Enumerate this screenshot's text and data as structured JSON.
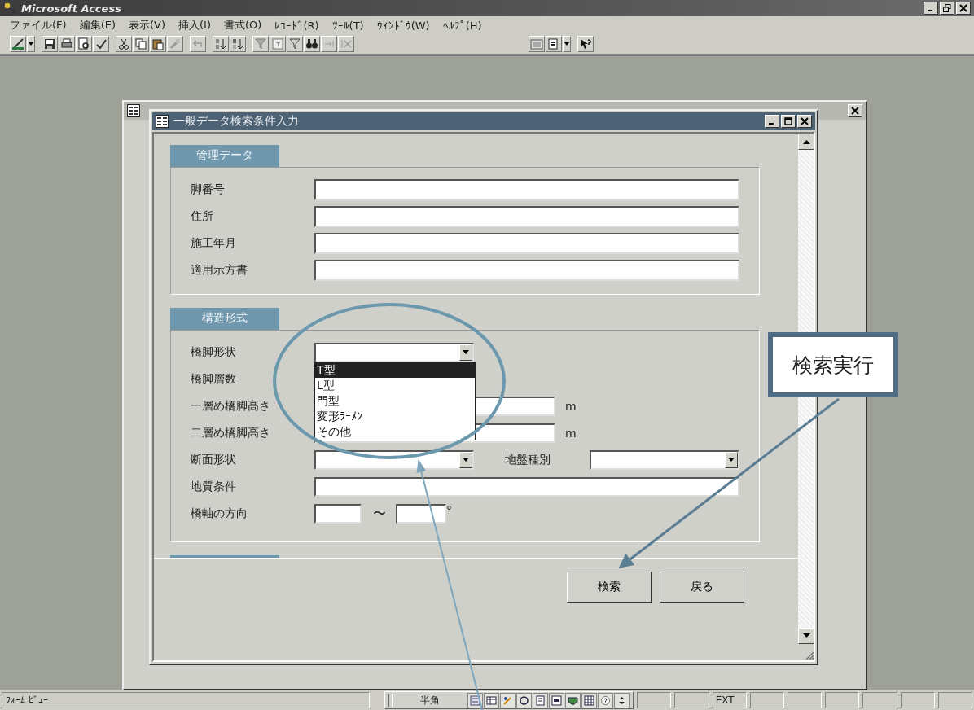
{
  "app": {
    "title": "Microsoft Access"
  },
  "menu": [
    "ファイル(F)",
    "編集(E)",
    "表示(V)",
    "挿入(I)",
    "書式(O)",
    "ﾚｺｰﾄﾞ(R)",
    "ﾂｰﾙ(T)",
    "ｳｨﾝﾄﾞｳ(W)",
    "ﾍﾙﾌﾟ(H)"
  ],
  "form": {
    "title": "一般データ検索条件入力",
    "sections": [
      {
        "title": "管理データ",
        "rows": [
          {
            "kind": "text",
            "label": "脚番号"
          },
          {
            "kind": "text",
            "label": "住所"
          },
          {
            "kind": "text",
            "label": "施工年月"
          },
          {
            "kind": "text",
            "label": "適用示方書"
          }
        ]
      },
      {
        "title": "構造形式",
        "rows": [
          {
            "kind": "combo",
            "label": "橋脚形状",
            "open": true,
            "options": [
              {
                "label": "T型",
                "selected": true
              },
              {
                "label": "L型",
                "selected": false
              },
              {
                "label": "門型",
                "selected": false
              },
              {
                "label": "変形ﾗｰﾒﾝ",
                "selected": false
              },
              {
                "label": "その他",
                "selected": false
              }
            ]
          },
          {
            "kind": "label",
            "label": "橋脚層数"
          },
          {
            "kind": "unit",
            "label": "一層め橋脚高さ",
            "unit": "m"
          },
          {
            "kind": "unit",
            "label": "二層め橋脚高さ",
            "unit": "m"
          },
          {
            "kind": "combo2",
            "label": "断面形状",
            "second_label": "地盤種別"
          },
          {
            "kind": "text",
            "label": "地質条件"
          },
          {
            "kind": "range",
            "label": "橋軸の方向",
            "separator": "〜",
            "unit": "°"
          }
        ]
      }
    ],
    "buttons": [
      "検索",
      "戻る"
    ]
  },
  "callout": {
    "text": "検索実行"
  },
  "status_bar": {
    "mode": "ﾌｫｰﾑ ﾋﾞｭｰ",
    "ime": "半角",
    "indicator": "EXT"
  }
}
